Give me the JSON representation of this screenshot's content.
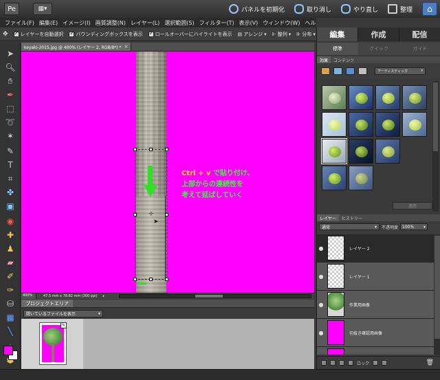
{
  "topbar": {
    "reset_panels": "パネルを初期化",
    "undo": "取り消し",
    "redo": "やり直し",
    "organize": "整理"
  },
  "menu": [
    "ファイル(F)",
    "編集(E)",
    "イメージ(I)",
    "画質調整(N)",
    "レイヤー(L)",
    "選択範囲(S)",
    "フィルター(T)",
    "表示(V)",
    "ウィンドウ(W)",
    "ヘルプ(H)"
  ],
  "options": {
    "auto_select": "レイヤーを自動選択",
    "bounding_box": "バウンディングボックスを表示",
    "rollover": "ロールオーバーにハイライトを表示",
    "arrange": "アレンジ",
    "align": "整列",
    "distribute": "分布"
  },
  "document": {
    "tab_title": "keyaki-2015.jpg @ 400% (レイヤー 2, RGB/8*) *",
    "close": "×",
    "zoom": "400%",
    "info": "47.5 mm x 78.82 mm (300 ppi)"
  },
  "annotation": {
    "line1_key": "Ctrl + v",
    "line1_rest": " で貼り付け、",
    "line2": "上部からの連続性を",
    "line3": "考えて延ばしていく"
  },
  "project": {
    "tab": "プロジェクトエリア",
    "show_select": "開いているファイルを表示"
  },
  "right": {
    "modes": [
      "編集",
      "作成",
      "配信"
    ],
    "subtabs": [
      "標準",
      "クイック",
      "ガイド"
    ],
    "fx_tabs": [
      "効果",
      "コンテンツ"
    ],
    "fx_dropdown": "アーティスティック",
    "apply": "適用",
    "layer_tabs": [
      "レイヤー",
      "ヒストリー"
    ],
    "blend_mode": "通常",
    "opacity_label": "不透明度",
    "opacity": "100%",
    "lock": "ロック",
    "layers": [
      {
        "name": "レイヤー 2",
        "thumb": "checker",
        "active": true
      },
      {
        "name": "レイヤー 1",
        "thumb": "checker",
        "active": false
      },
      {
        "name": "作業用画像",
        "thumb": "tree",
        "active": false
      },
      {
        "name": "切抜き確認用画像",
        "thumb": "magenta",
        "active": false
      },
      {
        "name": "",
        "thumb": "magenta-tree",
        "active": false
      }
    ]
  },
  "colors": {
    "canvas_bg": "#ff00ff",
    "annotation_green": "#3cf53a",
    "annotation_key": "#ffe600",
    "arrow": "#2fe023"
  }
}
